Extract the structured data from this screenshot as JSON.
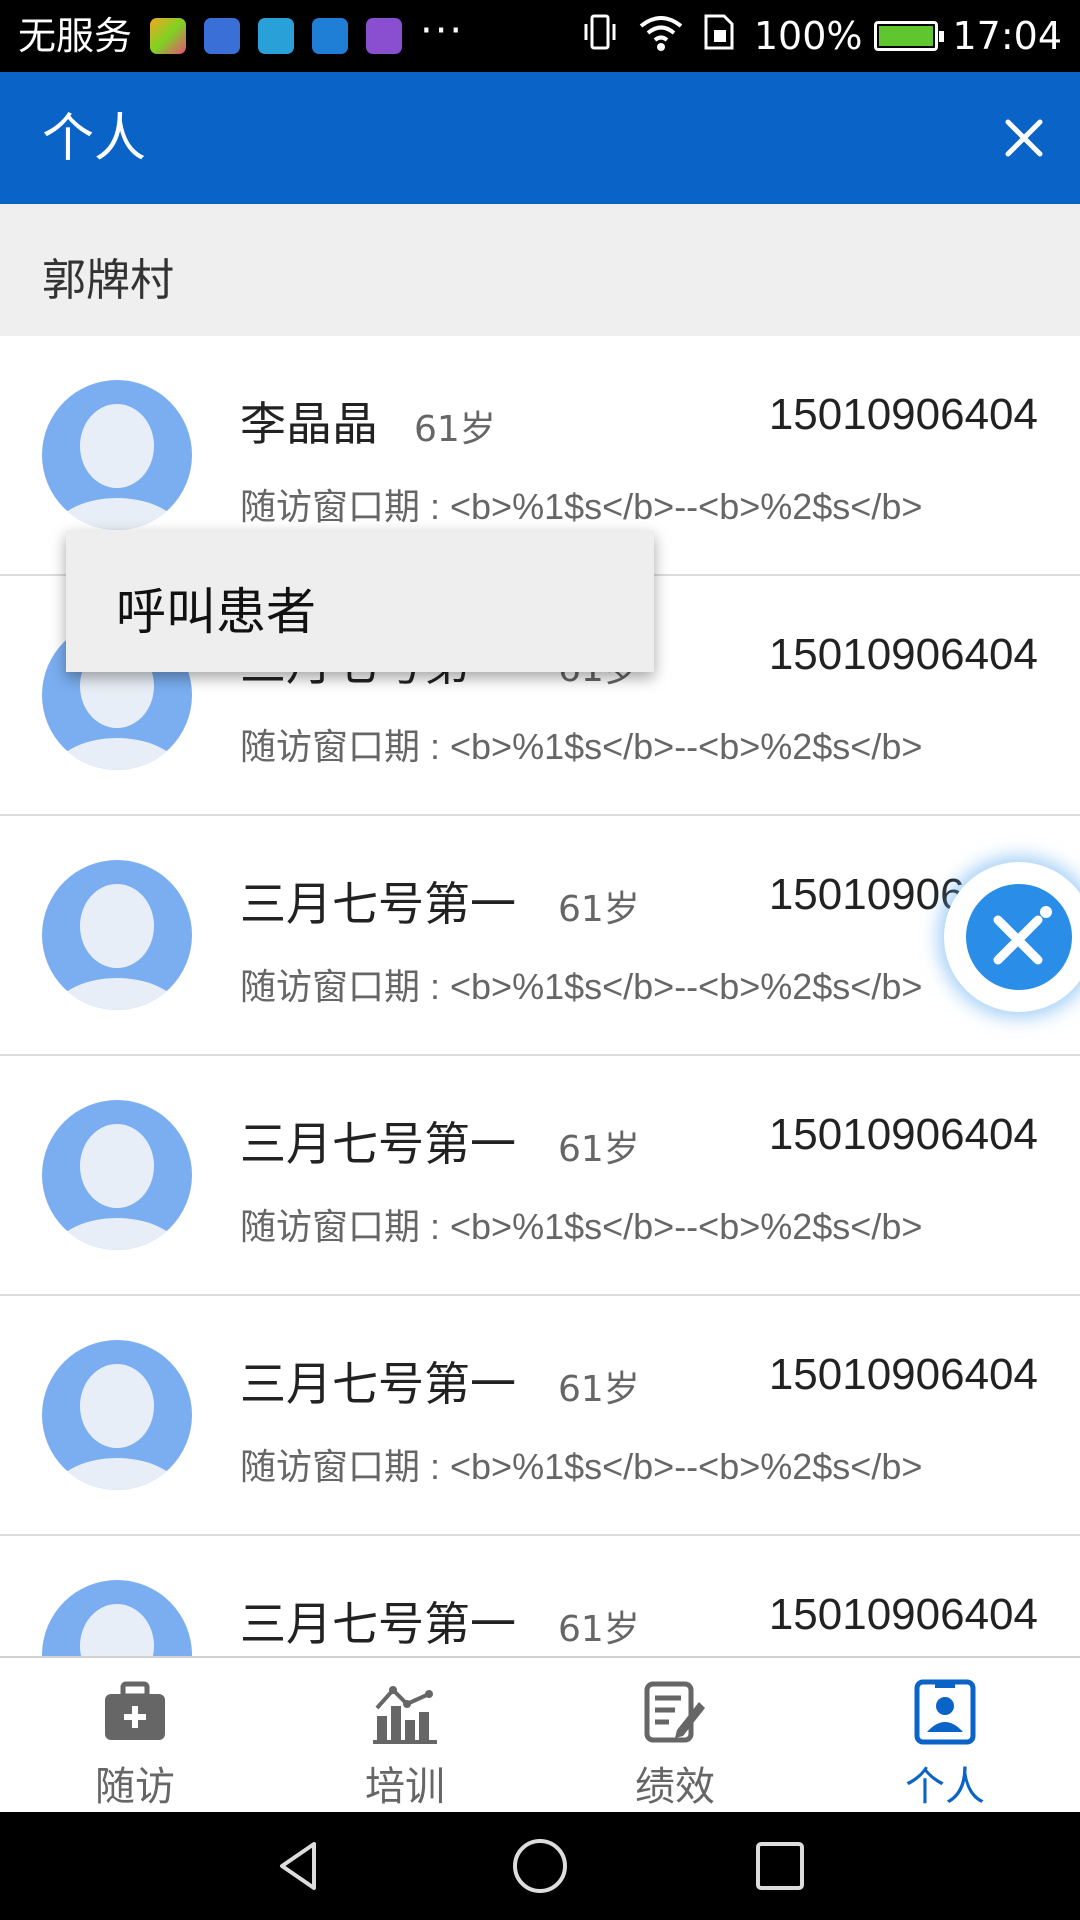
{
  "status_bar": {
    "carrier": "无服务",
    "more": "···",
    "battery_percent": "100%",
    "time": "17:04",
    "battery_level": 1.0,
    "app_icons": [
      "app-icon-1",
      "health-icon",
      "exu-icon",
      "usb-icon",
      "keyboard-icon"
    ]
  },
  "app_bar": {
    "title": "个人",
    "close_icon": "close-icon"
  },
  "section": {
    "title": "郭牌村"
  },
  "patients": [
    {
      "name": "李晶晶",
      "age": "61岁",
      "phone": "15010906404",
      "window_label": "随访窗口期 : <b>%1$s</b>--<b>%2$s</b>"
    },
    {
      "name": "三月七号第一",
      "age": "61岁",
      "phone": "15010906404",
      "window_label": "随访窗口期 : <b>%1$s</b>--<b>%2$s</b>"
    },
    {
      "name": "三月七号第一",
      "age": "61岁",
      "phone": "15010906404",
      "window_label": "随访窗口期 : <b>%1$s</b>--<b>%2$s</b>"
    },
    {
      "name": "三月七号第一",
      "age": "61岁",
      "phone": "15010906404",
      "window_label": "随访窗口期 : <b>%1$s</b>--<b>%2$s</b>"
    },
    {
      "name": "三月七号第一",
      "age": "61岁",
      "phone": "15010906404",
      "window_label": "随访窗口期 : <b>%1$s</b>--<b>%2$s</b>"
    },
    {
      "name": "三月七号第一",
      "age": "61岁",
      "phone": "15010906404",
      "window_label": ""
    }
  ],
  "popup_menu": {
    "items": [
      "呼叫患者"
    ]
  },
  "bottom_nav": {
    "items": [
      {
        "label": "随访",
        "icon": "medical-kit-icon",
        "active": false
      },
      {
        "label": "培训",
        "icon": "chart-icon",
        "active": false
      },
      {
        "label": "绩效",
        "icon": "edit-document-icon",
        "active": false
      },
      {
        "label": "个人",
        "icon": "id-badge-icon",
        "active": true
      }
    ]
  },
  "colors": {
    "primary": "#0a63c6",
    "section_bg": "#efefef",
    "avatar": "#7aaef0",
    "battery_fill": "#5fc62f"
  }
}
